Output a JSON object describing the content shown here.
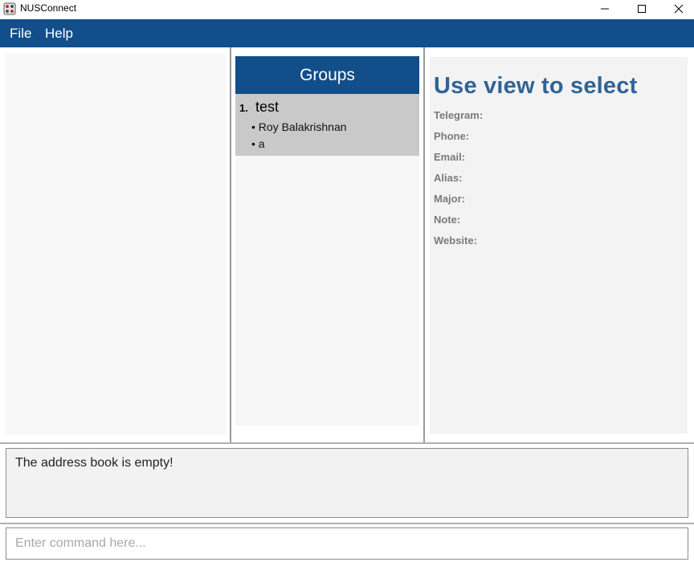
{
  "window": {
    "title": "NUSConnect",
    "icon": "nus-crest-icon"
  },
  "menu": {
    "file": "File",
    "help": "Help"
  },
  "groups_panel": {
    "header": "Groups",
    "groups": [
      {
        "index": "1.",
        "name": "test",
        "members": [
          "• Roy Balakrishnan",
          "• a"
        ]
      }
    ]
  },
  "details_panel": {
    "title": "Use view to select",
    "fields": [
      "Telegram:",
      "Phone:",
      "Email:",
      "Alias:",
      "Major:",
      "Note:",
      "Website:"
    ]
  },
  "result": {
    "text": "The address book is empty!"
  },
  "command": {
    "placeholder": "Enter command here...",
    "value": ""
  },
  "colors": {
    "accent": "#114e8a",
    "detail_title": "#2f6496"
  }
}
